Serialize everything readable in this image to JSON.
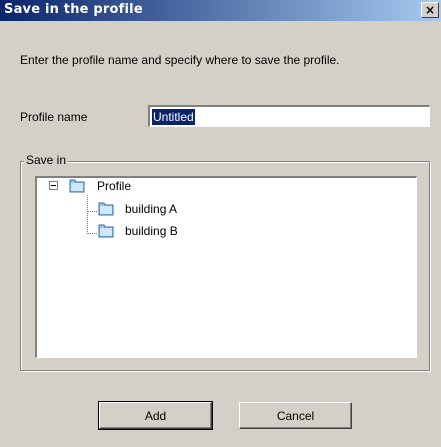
{
  "window": {
    "title": "Save in the profile",
    "close_symbol": "×"
  },
  "dialog": {
    "instruction": "Enter the profile name and specify where to save the profile.",
    "profile_name_label": "Profile name",
    "profile_name_value": "Untitled",
    "save_in_label": "Save in",
    "tree": {
      "root": {
        "label": "Profile",
        "icon": "folder-icon",
        "expanded": true
      },
      "children": [
        {
          "label": "building A",
          "icon": "folder-icon"
        },
        {
          "label": "building B",
          "icon": "folder-icon"
        }
      ]
    },
    "buttons": {
      "add": "Add",
      "cancel": "Cancel"
    }
  },
  "colors": {
    "titlebar_start": "#0a246a",
    "titlebar_end": "#a6caf0",
    "dialog_bg": "#d4d0c8",
    "selection": "#0a246a",
    "folder_fill": "#8ec8f0"
  }
}
